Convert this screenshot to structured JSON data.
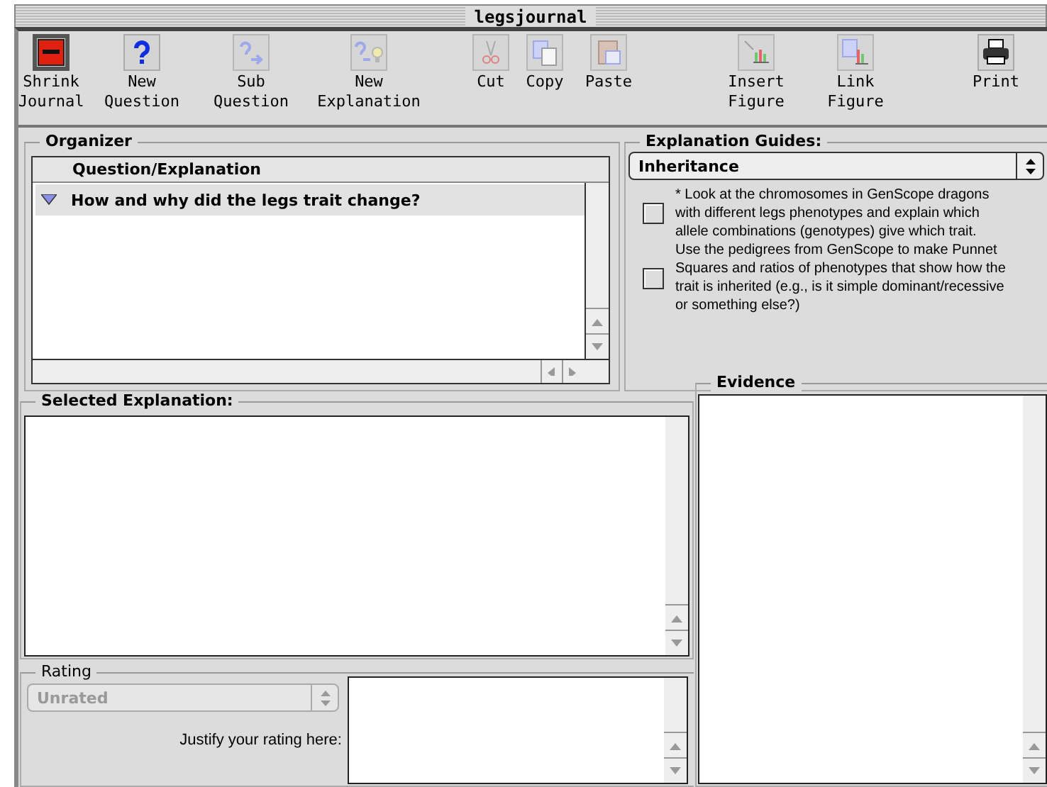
{
  "window": {
    "title": "legsjournal"
  },
  "toolbar": [
    {
      "label": "Shrink Journal",
      "kind": "journal",
      "pressed": true,
      "disabled": false
    },
    {
      "label": "New Question",
      "kind": "question",
      "pressed": false,
      "disabled": false
    },
    {
      "label": "Sub Question",
      "kind": "subquestion",
      "pressed": false,
      "disabled": true
    },
    {
      "label": "New Explanation",
      "kind": "explanation",
      "pressed": false,
      "disabled": true
    },
    {
      "label": "Cut",
      "kind": "cut",
      "pressed": false,
      "disabled": true
    },
    {
      "label": "Copy",
      "kind": "copy",
      "pressed": false,
      "disabled": true
    },
    {
      "label": "Paste",
      "kind": "paste",
      "pressed": false,
      "disabled": true
    },
    {
      "label": "Insert Figure",
      "kind": "insert",
      "pressed": false,
      "disabled": true
    },
    {
      "label": "Link Figure",
      "kind": "link",
      "pressed": false,
      "disabled": true
    },
    {
      "label": "Print",
      "kind": "print",
      "pressed": false,
      "disabled": false
    }
  ],
  "organizer": {
    "title": "Organizer",
    "column": "Question/Explanation",
    "rows": [
      {
        "text": "How and why did the legs trait change?",
        "expanded": true,
        "selected": true
      }
    ]
  },
  "guides": {
    "title": "Explanation Guides:",
    "select": "Inheritance",
    "items": [
      {
        "text": "* Look at the chromosomes in GenScope dragons with different legs phenotypes and explain which allele combinations (genotypes) give which trait.",
        "checked": false
      },
      {
        "text": "Use the pedigrees from GenScope to make Punnet Squares and ratios of phenotypes that show how the trait is inherited (e.g., is it simple dominant/recessive or something else?)",
        "checked": false
      }
    ]
  },
  "selected_explanation": {
    "title": "Selected Explanation:"
  },
  "rating": {
    "title": "Rating",
    "select": "Unrated",
    "select_disabled": true,
    "justify_label": "Justify your rating here:"
  },
  "evidence": {
    "title": "Evidence"
  }
}
